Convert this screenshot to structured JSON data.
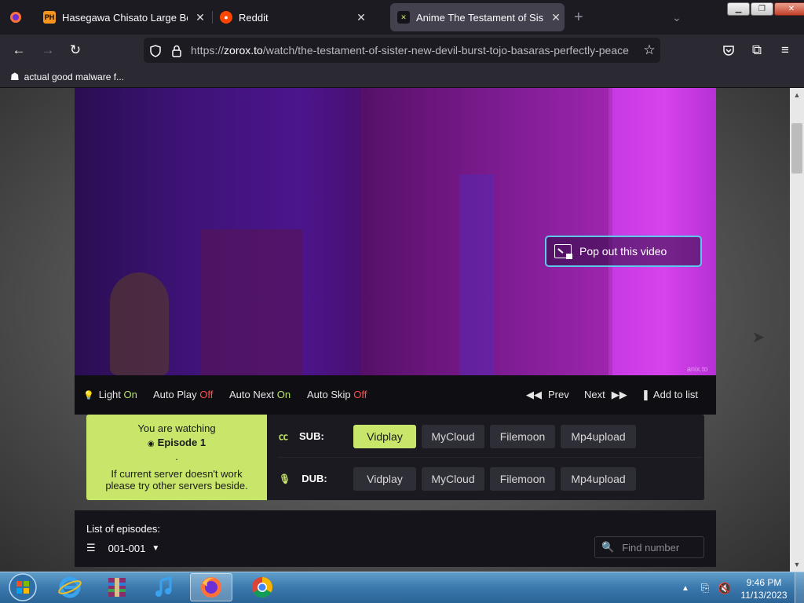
{
  "browser": {
    "tabs": [
      {
        "label": "Hasegawa Chisato Large Boobs",
        "favicon": "PH"
      },
      {
        "label": "Reddit"
      },
      {
        "label": "Anime The Testament of Sister New Devil",
        "active": true
      }
    ],
    "new_tab": "+",
    "url": {
      "scheme": "https://",
      "host": "zorox.to",
      "path": "/watch/the-testament-of-sister-new-devil-burst-tojo-basaras-perfectly-peace"
    },
    "bookmarks": [
      "actual good malware f..."
    ]
  },
  "player": {
    "popout_label": "Pop out this video",
    "watermark": "anix.to",
    "controls": {
      "light": {
        "label": "Light",
        "state": "On"
      },
      "autoplay": {
        "label": "Auto Play",
        "state": "Off"
      },
      "autonext": {
        "label": "Auto Next",
        "state": "On"
      },
      "autoskip": {
        "label": "Auto Skip",
        "state": "Off"
      },
      "prev": "Prev",
      "next": "Next",
      "add_to_list": "Add to list"
    }
  },
  "watching": {
    "line1": "You are watching",
    "episode": "Episode 1",
    "dot": ".",
    "line2": "If current server doesn't work",
    "line3": "please try other servers beside."
  },
  "servers": {
    "sub": {
      "label": "SUB:",
      "options": [
        "Vidplay",
        "MyCloud",
        "Filemoon",
        "Mp4upload"
      ],
      "selected": "Vidplay"
    },
    "dub": {
      "label": "DUB:",
      "options": [
        "Vidplay",
        "MyCloud",
        "Filemoon",
        "Mp4upload"
      ]
    }
  },
  "episodes": {
    "label": "List of episodes:",
    "range": "001-001",
    "find_placeholder": "Find number"
  },
  "taskbar": {
    "time": "9:46 PM",
    "date": "11/13/2023"
  },
  "colors": {
    "accent": "#c7e66a",
    "on": "#b9e36a",
    "off": "#ff4d4d",
    "popout_border": "#5ec8ea"
  }
}
